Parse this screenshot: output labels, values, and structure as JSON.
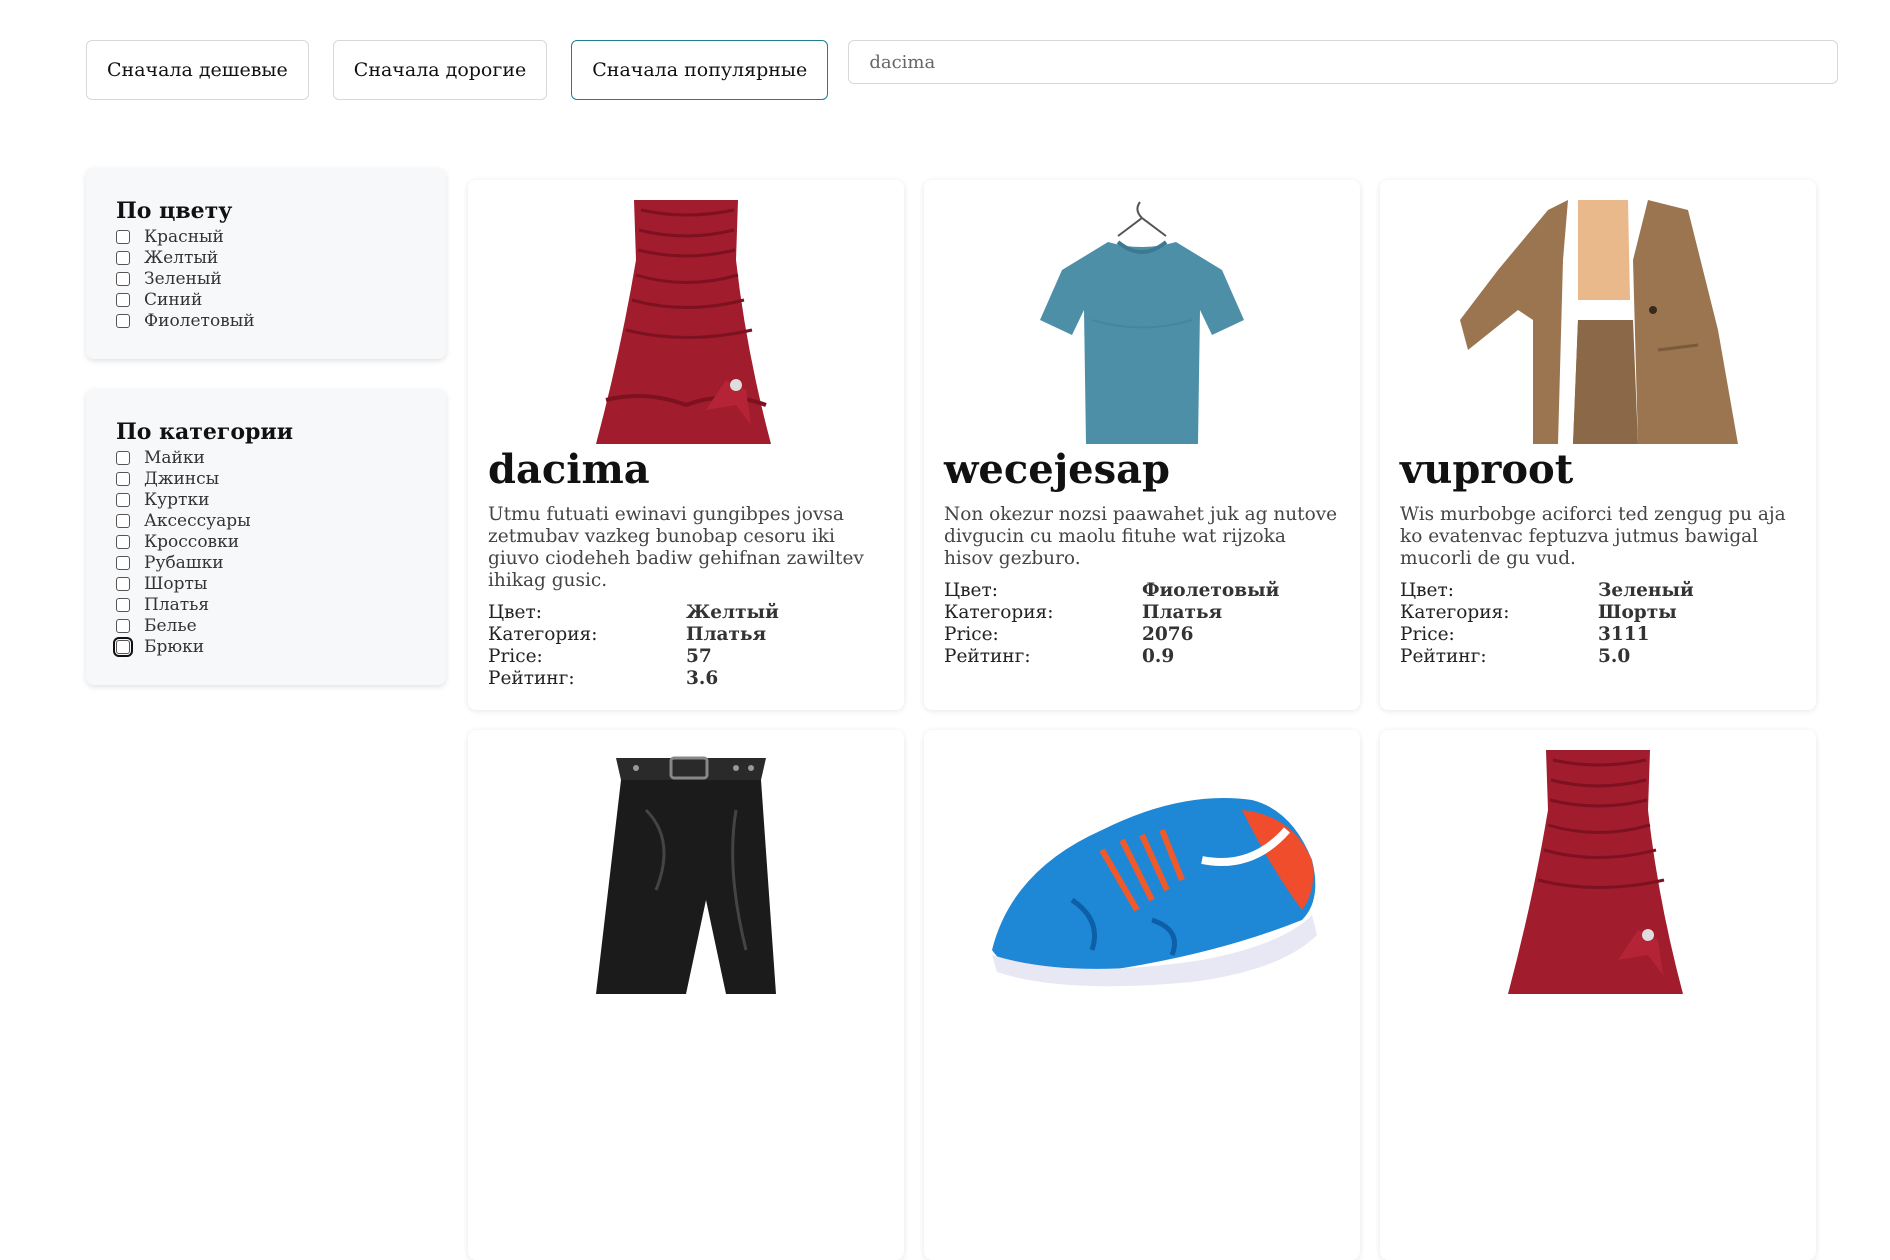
{
  "sort": {
    "cheap_first": "Сначала дешевые",
    "expensive_first": "Сначала дорогие",
    "popular_first": "Сначала популярные"
  },
  "search": {
    "value": "dacima",
    "placeholder": ""
  },
  "filters": {
    "color": {
      "title": "По цвету",
      "items": [
        "Красный",
        "Желтый",
        "Зеленый",
        "Синий",
        "Фиолетовый"
      ]
    },
    "category": {
      "title": "По категории",
      "items": [
        "Майки",
        "Джинсы",
        "Куртки",
        "Аксессуары",
        "Кроссовки",
        "Рубашки",
        "Шорты",
        "Платья",
        "Белье",
        "Брюки"
      ]
    }
  },
  "labels": {
    "color": "Цвет:",
    "category": "Категория:",
    "price": "Price:",
    "rating": "Рейтинг:"
  },
  "products": [
    {
      "title": "dacima",
      "image": "red-dress",
      "description": "Utmu futuati ewinavi gungibpes jovsa zetmubav vazkeg bunobap cesoru iki giuvo ciodeheh badiw gehifnan zawiltev ihikag gusic.",
      "color": "Желтый",
      "category": "Платья",
      "price": "57",
      "rating": "3.6"
    },
    {
      "title": "wecejesap",
      "image": "blue-tshirt",
      "description": "Non okezur nozsi paawahet juk ag nutove divgucin cu maolu fituhe wat rijzoka hisov gezburo.",
      "color": "Фиолетовый",
      "category": "Платья",
      "price": "2076",
      "rating": "0.9"
    },
    {
      "title": "vuproot",
      "image": "brown-blazer",
      "description": "Wis murbobge aciforci ted zengug pu aja ko evatenvac feptuzva jutmus bawigal mucorli de gu vud.",
      "color": "Зеленый",
      "category": "Шорты",
      "price": "3111",
      "rating": "5.0"
    },
    {
      "image": "black-leather-shorts"
    },
    {
      "image": "blue-sneaker"
    },
    {
      "image": "red-dress"
    }
  ],
  "colors": {
    "active_border": "#1f7e90",
    "panel_bg": "#f7f8fa"
  }
}
